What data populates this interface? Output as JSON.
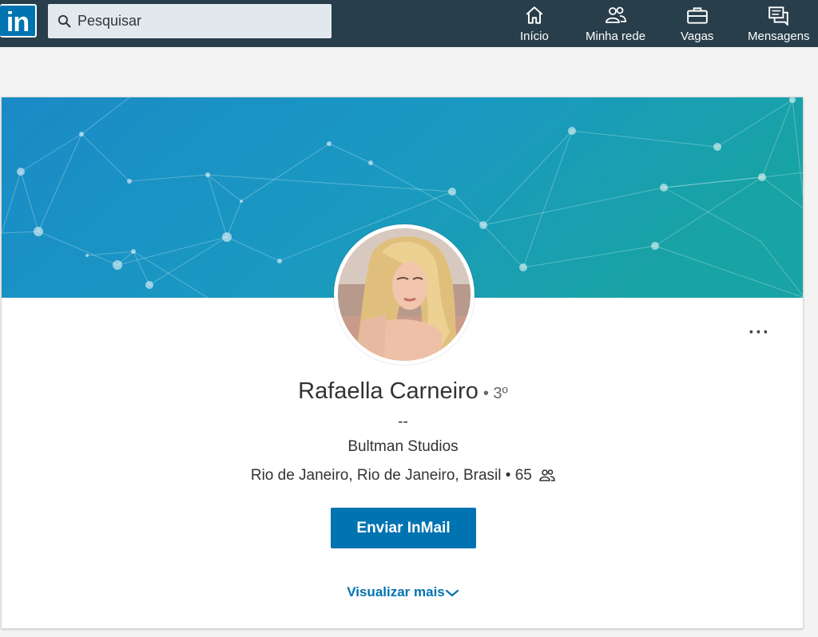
{
  "nav": {
    "logo_text": "in",
    "search": {
      "placeholder": "Pesquisar",
      "value": ""
    },
    "items": [
      {
        "label": "Início",
        "icon": "home-icon"
      },
      {
        "label": "Minha rede",
        "icon": "network-icon"
      },
      {
        "label": "Vagas",
        "icon": "briefcase-icon"
      },
      {
        "label": "Mensagens",
        "icon": "messages-icon"
      }
    ]
  },
  "profile": {
    "name": "Rafaella Carneiro",
    "degree": "• 3º",
    "headline": "--",
    "company": "Bultman Studios",
    "location": "Rio de Janeiro, Rio de Janeiro, Brasil",
    "connections": "• 65",
    "more_actions": "···",
    "primary_action": "Enviar InMail",
    "show_more": "Visualizar mais"
  },
  "colors": {
    "navbar": "#283e4a",
    "brand": "#0073b1",
    "banner_start": "#1a8fc7",
    "banner_end": "#18a0a3"
  }
}
